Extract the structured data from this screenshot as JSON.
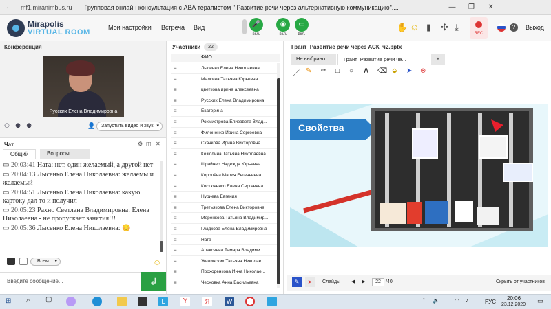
{
  "browser": {
    "url": "mf1.miranimbus.ru",
    "title": "Групповая онлайн консультация с АВА терапистом \" Развитие речи через альтернативную коммуникацию\"...."
  },
  "app": {
    "logo_line1": "Mirapolis",
    "logo_line2": "VIRTUAL ROOM",
    "menu": [
      "Мои настройки",
      "Встреча",
      "Вид"
    ],
    "controls": [
      {
        "label": "вкл.",
        "icon": "microphone-icon"
      },
      {
        "label": "вкл.",
        "icon": "camera-icon"
      },
      {
        "label": "вкл.",
        "icon": "screen-share-icon"
      }
    ],
    "rec_label": "REC",
    "exit_label": "Выход"
  },
  "conference": {
    "title": "Конференция",
    "speaker_name": "Русских Елена Владимировна",
    "start_video_label": "Запустить видео и звук"
  },
  "chat": {
    "title": "Чат",
    "tabs": [
      "Общий",
      "Вопросы"
    ],
    "messages": [
      {
        "time": "20:03:41",
        "text": "Ната: нет, один желаемый, а другой нет"
      },
      {
        "time": "20:04:13",
        "text": "Лысенко Елена  Николаевна: желаемы и желаемый"
      },
      {
        "time": "20:04:51",
        "text": "Лысенко Елена  Николаевна: какую картоку дал то и получил"
      },
      {
        "time": "20:05:23",
        "text": "Рахно Светлана  Владимировна: Елена Николаевна - не пропускает занятия!!!"
      },
      {
        "time": "20:05:36",
        "text": "Лысенко Елена  Николаевна: 😊"
      }
    ],
    "recipient": "Всем",
    "input_placeholder": "Введите сообщение..."
  },
  "participants": {
    "title": "Участники",
    "count": "22",
    "column_header": "ФИО",
    "list": [
      "Лысенко Елена  Николаевна",
      "Малкина Татьяна  Юрьевна",
      "цветкова  ирина алексеевна",
      "Русских Елена Владимировна",
      "Екатерина",
      "Рохмистрова  Елизавета Влад...",
      "Филоненко Ирина  Сергеевна",
      "Скачкова  Ирина Викторовна",
      "Козюлина  Татьяна Николаевна",
      "Шрайнер Надежда  Юрьевна",
      "Королёва Мария Евгеньевна",
      "Костюченко  Елена Сергеевна",
      "Нуриева Евгения",
      "Третьякова  Елена Викторовна",
      "Меренкова  Татьяна  Владимир...",
      "Гладкова Елена Владимировна",
      "Ната",
      "Алексеева  Тамара  Владими...",
      "Жилинских  Татьяна Николае...",
      "Прохоренкова  Инна Николае...",
      "Чесновка  Анна  Васильевна"
    ]
  },
  "document": {
    "title": "Грант_Развитие речи через АСК_ч2.pptx",
    "tabs": [
      "Не выбрано",
      "Грант_Развитие речи че...",
      "+"
    ],
    "slide_heading": "Свойства",
    "slides_label": "Слайды",
    "current_slide": "22",
    "total_slides": "/40",
    "hide_label": "Скрыть от участников"
  },
  "taskbar": {
    "lang": "РУС",
    "time": "20:06",
    "date": "23.12.2020"
  },
  "colors": {
    "green": "#27a844",
    "brand_dark": "#2f3c54",
    "brand_light": "#58b6e6",
    "rec_red": "#d33"
  }
}
